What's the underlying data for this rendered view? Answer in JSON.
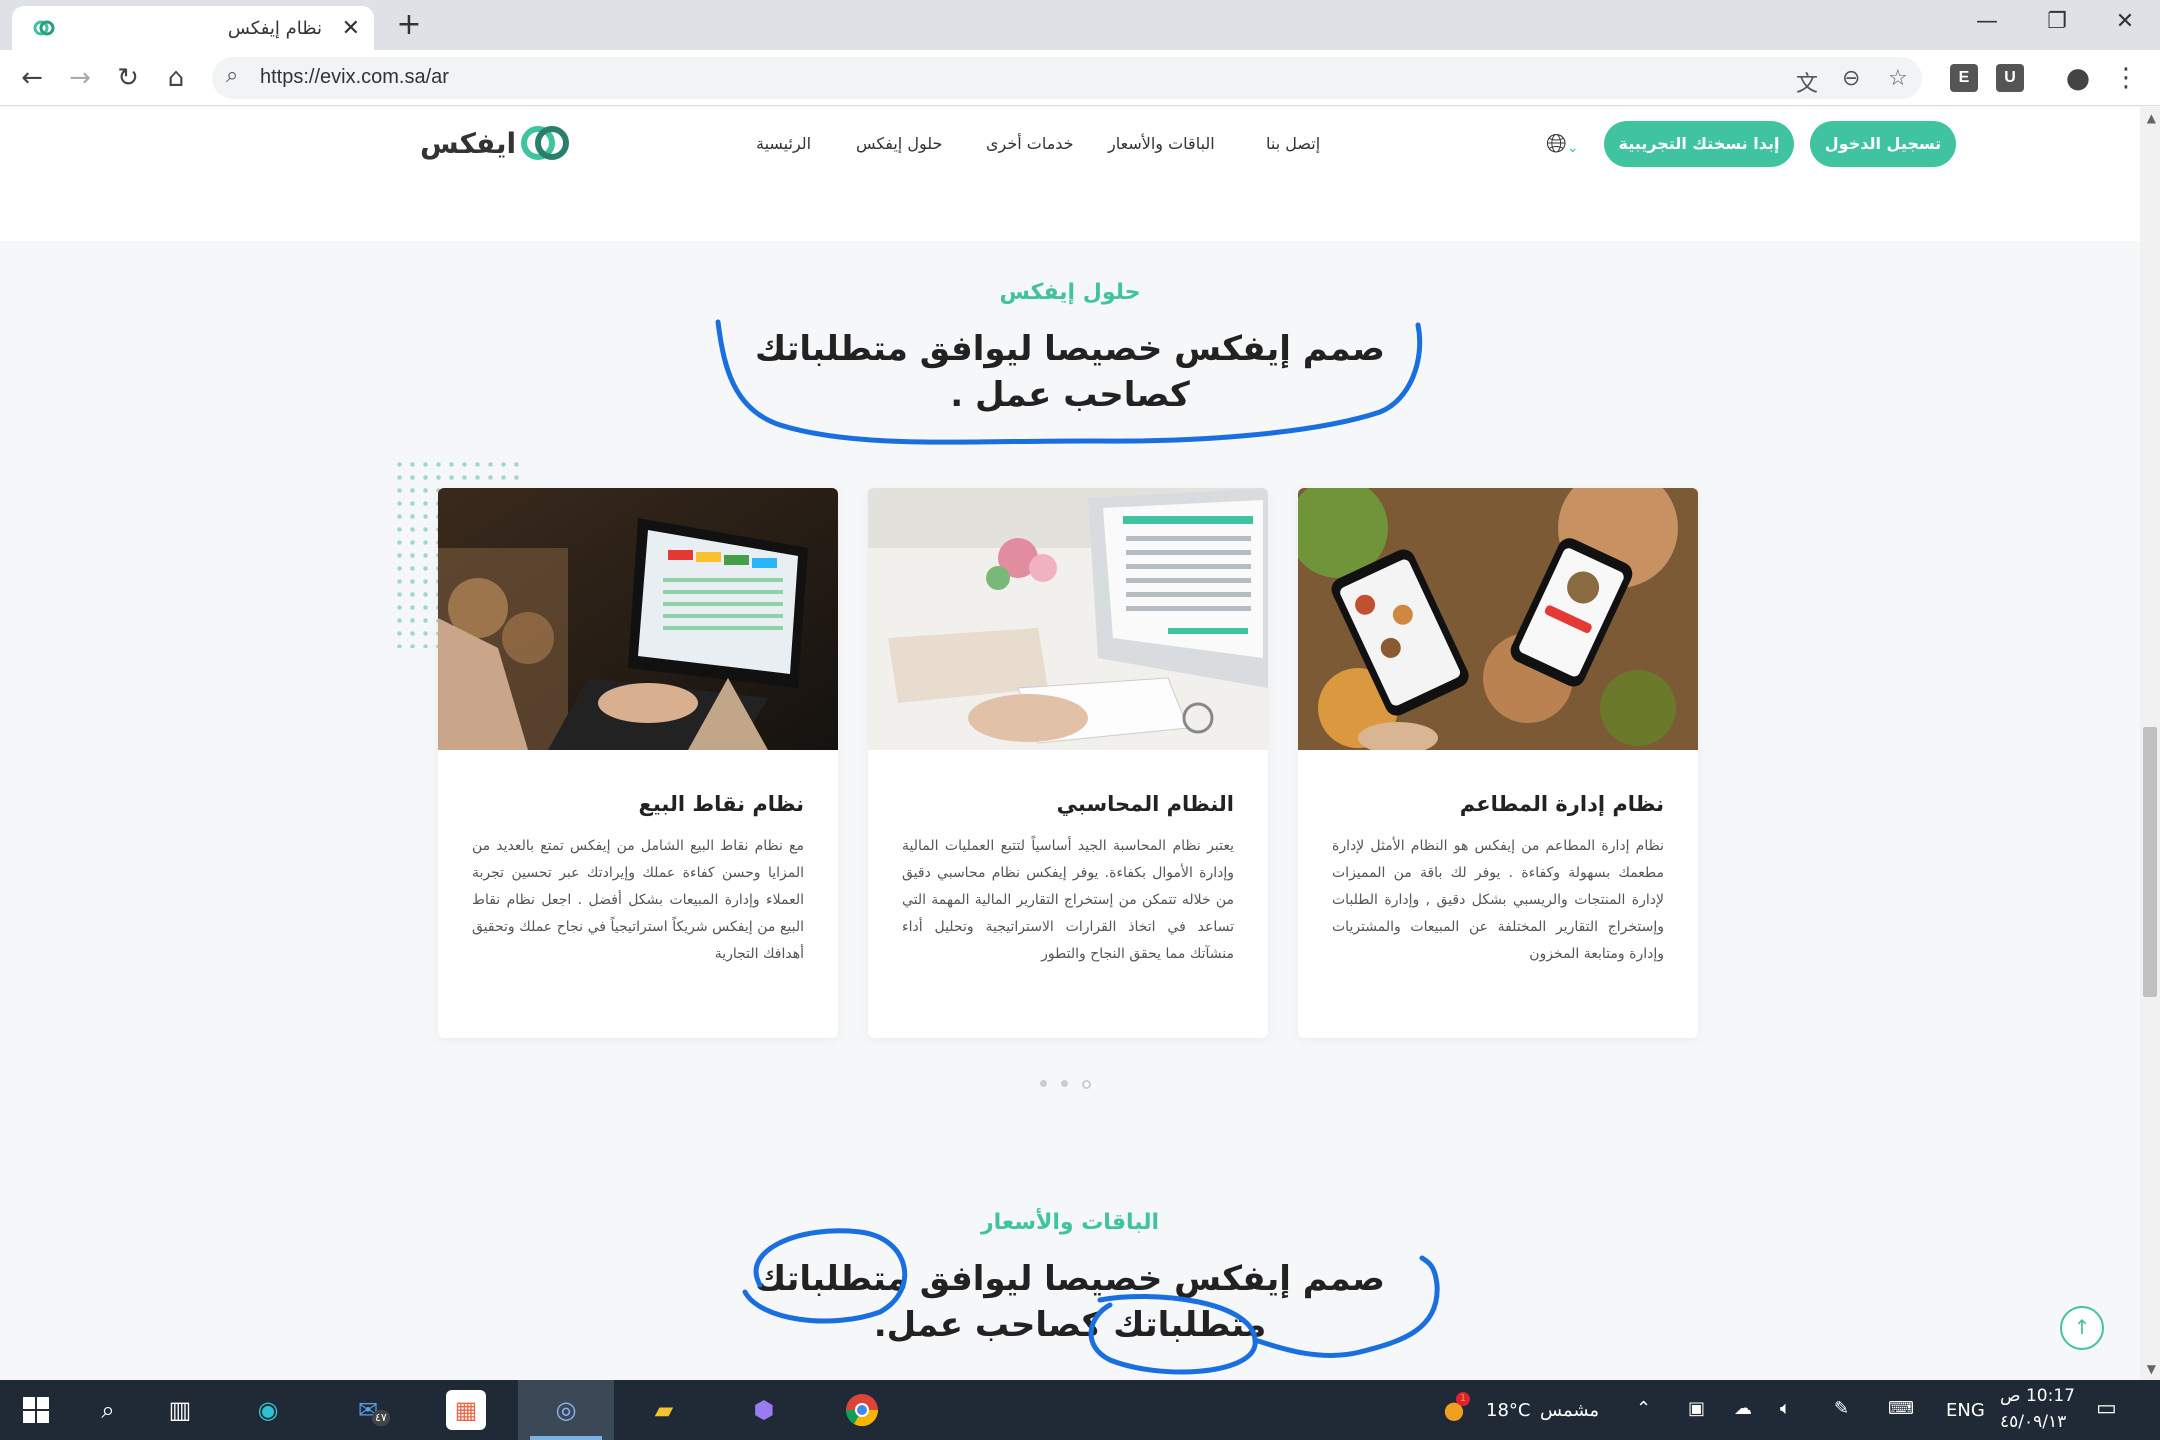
{
  "browser": {
    "tab_title": "نظام إيفكس",
    "tab_close": "✕",
    "new_tab": "+",
    "url": "https://evix.com.sa/ar",
    "win_minimize": "—",
    "win_restore": "❐",
    "win_close": "✕",
    "ext1": "E",
    "ext2": "U"
  },
  "header": {
    "logo_text": "ايفكس",
    "menu": [
      "الرئيسية",
      "حلول إيفكس",
      "خدمات أخرى",
      "الباقات والأسعار",
      "إتصل بنا"
    ],
    "login_button": "تسجيل الدخول",
    "trial_button": "إبدا نسختك التجريبية",
    "lang_chevron": "⌄"
  },
  "solutions": {
    "eyebrow": "حلول إيفكس",
    "headline_line1": "صمم إيفكس خصيصا ليوافق متطلباتك",
    "headline_line2": "كصاحب عمل ."
  },
  "cards": [
    {
      "title": "نظام إدارة المطاعم",
      "text": "نظام إدارة المطاعم من إيفكس هو النظام الأمثل لإدارة مطعمك بسهولة وكفاءة . يوفر لك باقة من المميزات لإدارة المنتجات والريسبي بشكل دقيق , وإدارة الطلبات وإستخراج التقارير المختلفة عن المبيعات والمشتريات وإدارة ومتابعة المخزون"
    },
    {
      "title": "النظام المحاسبي",
      "text": "يعتبر نظام المحاسبة الجيد أساسياً لتتبع العمليات المالية وإدارة الأموال بكفاءة. يوفر إيفكس نظام محاسبي دقيق من خلاله تتمكن من إستخراج التقارير المالية المهمة التي تساعد في اتخاذ القرارات الاستراتيجية وتحليل أداء منشآتك مما يحقق النجاح والتطور"
    },
    {
      "title": "نظام نقاط البيع",
      "text": "مع نظام نقاط البيع الشامل من إيفكس تمتع بالعديد من المزايا وحسن كفاءة عملك وإيرادتك عبر تحسين تجربة العملاء وإدارة المبيعات بشكل أفضل . اجعل نظام نقاط البيع من إيفكس شريكاً استراتيجياً في نجاح عملك وتحقيق أهدافك التجارية"
    }
  ],
  "pricing": {
    "eyebrow": "الباقات والأسعار",
    "headline_line1": "صمم إيفكس خصيصا ليوافق متطلباتك",
    "headline_line2": "متطلباتك كصاحب عمل."
  },
  "taskbar": {
    "mail_badge": "٤٧",
    "weather_temp": "18°C",
    "weather_label": "مشمس",
    "weather_badge": "1",
    "language": "ENG",
    "time": "10:17 ص",
    "date": "٤٥/٠٩/١٣"
  },
  "colors": {
    "accent": "#3fc3a0",
    "annotation": "#1a6fe0",
    "taskbar": "#1f2a36"
  }
}
